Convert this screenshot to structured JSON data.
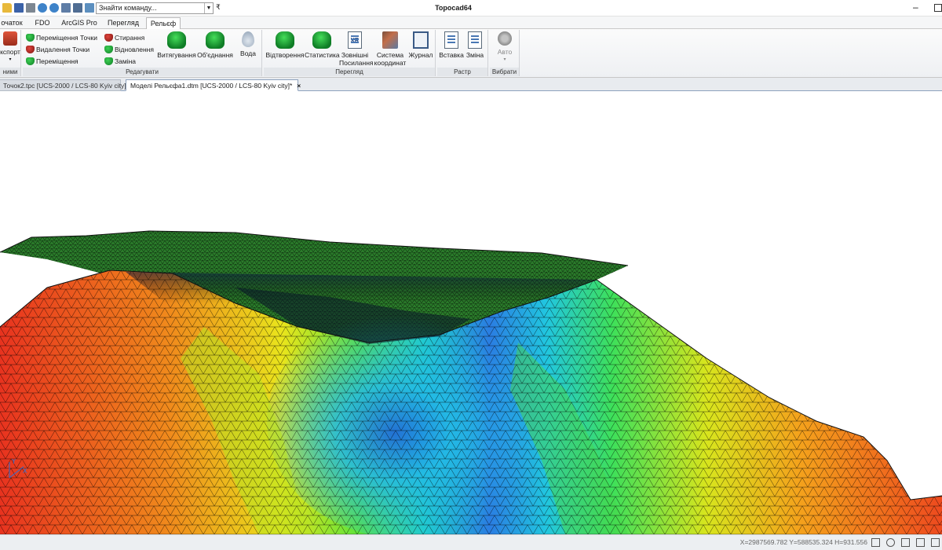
{
  "app": {
    "title": "Topocad64"
  },
  "quick_access": {
    "search_placeholder": "Знайти команду...",
    "more": "₹"
  },
  "tabs": [
    {
      "label": "очаток"
    },
    {
      "label": "FDO"
    },
    {
      "label": "ArcGIS Pro"
    },
    {
      "label": "Перегляд"
    },
    {
      "label": "Рельєф",
      "active": true
    }
  ],
  "ribbon": {
    "export": {
      "label": "кспорт",
      "group": "ними"
    },
    "edit": {
      "group": "Редагувати",
      "small_col1": [
        "Переміщення Точки",
        "Видалення Точки",
        "Переміщення"
      ],
      "small_col2": [
        "Стирання",
        "Відновлення",
        "Заміна"
      ],
      "extrude": "Витягування",
      "merge": "Об'єднання",
      "water": "Вода"
    },
    "view": {
      "group": "Перегляд",
      "render": "Відтворення",
      "stats": "Статистика",
      "xref_line1": "Зовнішні",
      "xref_line2": "Посилання",
      "xref_icon_text": "XR",
      "coordsys_line1": "Система",
      "coordsys_line2": "координат",
      "journal": "Журнал"
    },
    "raster": {
      "group": "Растр",
      "insert": "Вставка",
      "change": "Зміна"
    },
    "select": {
      "group": "Вибрати",
      "auto": "Авто"
    }
  },
  "doc_tabs": [
    {
      "label": "Точок2.tpc [UCS-2000 / LCS-80 Kyiv city]*",
      "active": false
    },
    {
      "label": "Моделі Рельєфа1.dtm [UCS-2000 / LCS-80 Kyiv city]*",
      "active": true,
      "close": "×"
    }
  ],
  "status": {
    "coords": "X=2987569.782 Y=588535.324 H=931.556"
  },
  "axis": {
    "x": "X",
    "y": "Y"
  },
  "colors": {
    "accent_tab_border": "#8ea2bd",
    "ribbon_bg": "#eef0f3"
  }
}
